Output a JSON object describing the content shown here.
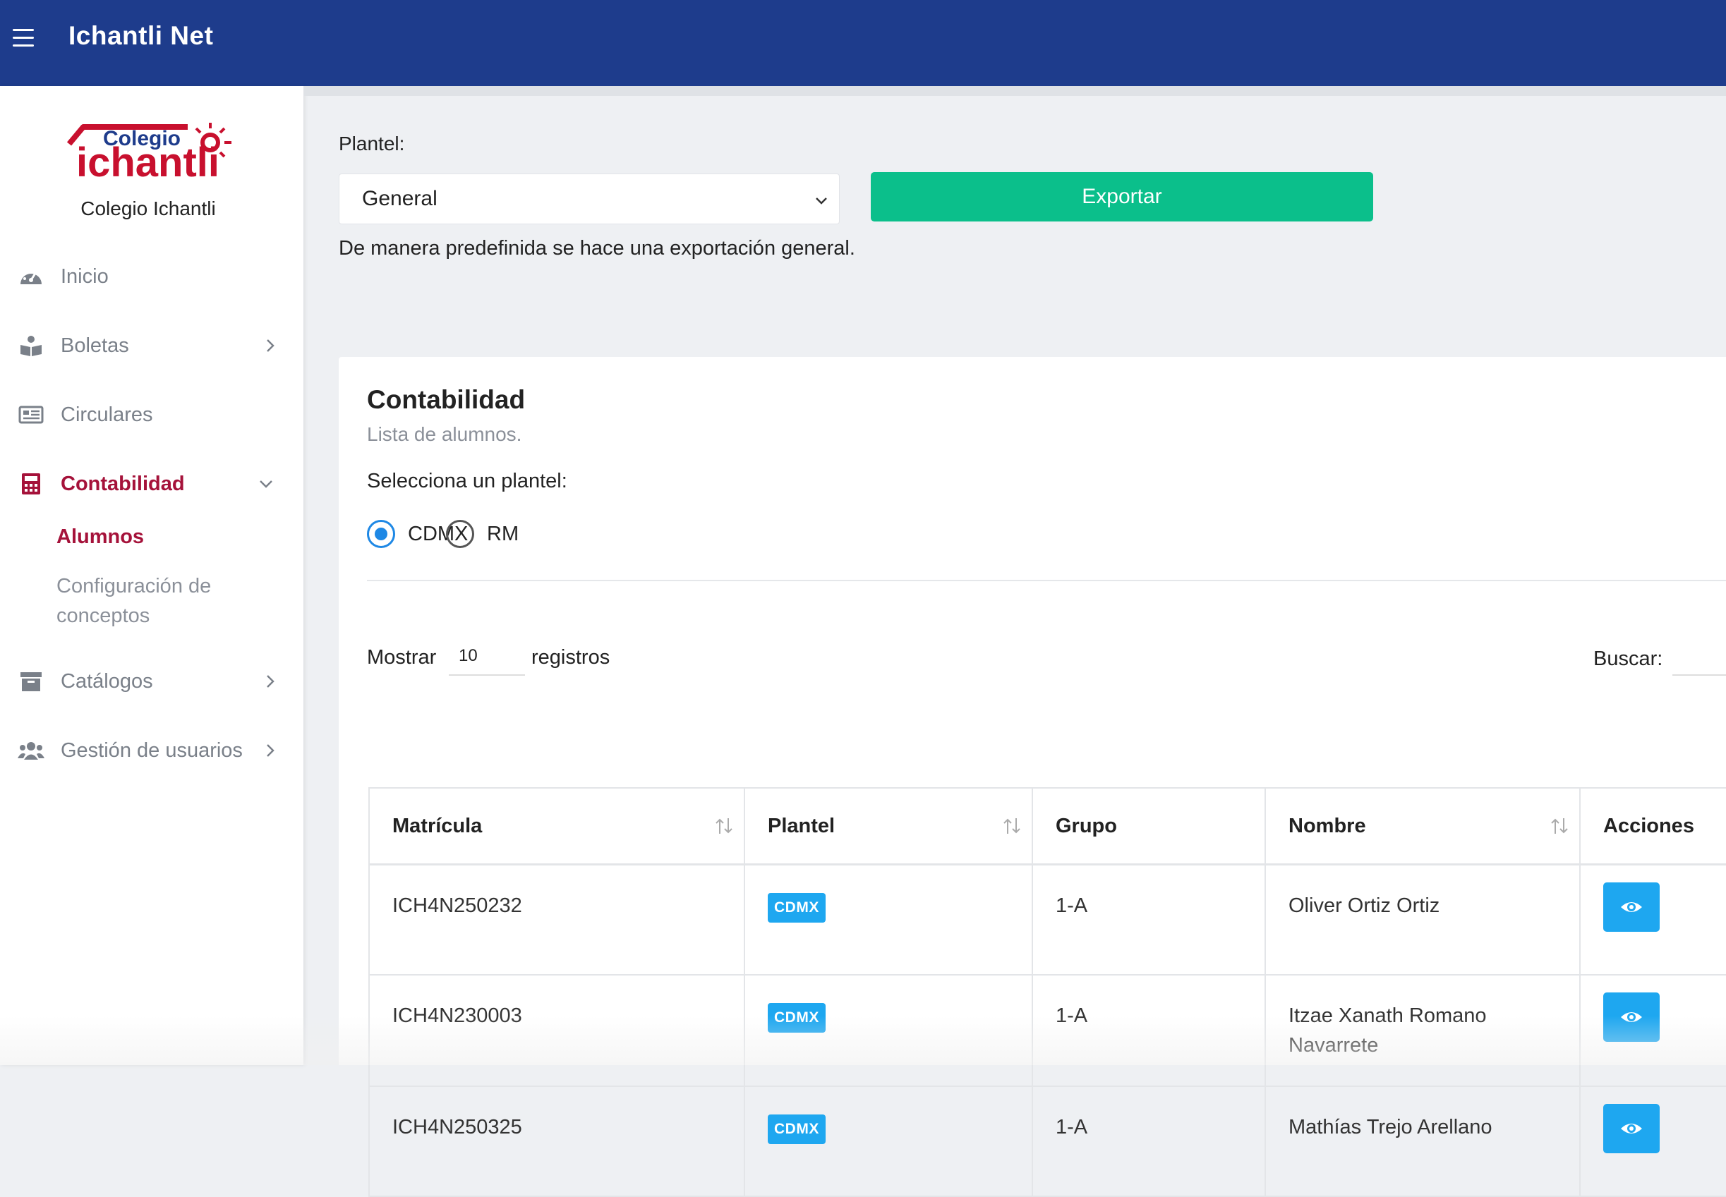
{
  "header": {
    "title": "Ichantli Net"
  },
  "sidebar": {
    "logo": {
      "top_text": "Colegio",
      "main_text": "ichantli"
    },
    "school_name": "Colegio Ichantli",
    "items": [
      {
        "label": "Inicio",
        "icon": "gauge-icon"
      },
      {
        "label": "Boletas",
        "icon": "reader-icon"
      },
      {
        "label": "Circulares",
        "icon": "newspaper-icon"
      },
      {
        "label": "Contabilidad",
        "icon": "calculator-icon"
      },
      {
        "label": "Catálogos",
        "icon": "archive-icon"
      },
      {
        "label": "Gestión de usuarios",
        "icon": "users-icon"
      }
    ],
    "subitems": [
      {
        "label": "Alumnos"
      },
      {
        "label": "Configuración de conceptos"
      }
    ]
  },
  "colors": {
    "topbar": "#1e3c8c",
    "accent": "#a5123a",
    "export": "#0bbf8b",
    "badge": "#1ea7f0"
  },
  "export_panel": {
    "plantel_label": "Plantel:",
    "selected": "General",
    "export_label": "Exportar",
    "note": "De manera predefinida se hace una exportación general."
  },
  "card": {
    "title": "Contabilidad",
    "subtitle": "Lista de alumnos.",
    "radio_label": "Selecciona un plantel:",
    "radios": [
      {
        "label": "CDMX",
        "checked": true
      },
      {
        "label": "RM",
        "checked": false
      }
    ],
    "show_label": "Mostrar",
    "show_value": "10",
    "records_label": "registros",
    "search_label": "Buscar:"
  },
  "table": {
    "headers": [
      "Matrícula",
      "Plantel",
      "Grupo",
      "Nombre",
      "Acciones"
    ],
    "rows": [
      {
        "matricula": "ICH4N250232",
        "plantel": "CDMX",
        "grupo": "1-A",
        "nombre": "Oliver Ortiz Ortiz"
      },
      {
        "matricula": "ICH4N230003",
        "plantel": "CDMX",
        "grupo": "1-A",
        "nombre": "Itzae Xanath Romano Navarrete"
      },
      {
        "matricula": "ICH4N250325",
        "plantel": "CDMX",
        "grupo": "1-A",
        "nombre": "Mathías Trejo Arellano"
      }
    ]
  }
}
